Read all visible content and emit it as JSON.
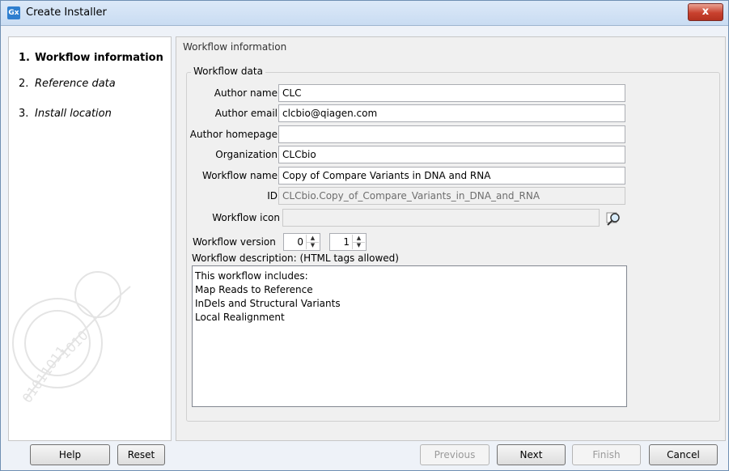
{
  "window": {
    "title": "Create Installer",
    "app_icon": "Gx",
    "close_label": "x"
  },
  "steps": [
    {
      "num": "1.",
      "label": "Workflow information",
      "state": "active"
    },
    {
      "num": "2.",
      "label": "Reference data",
      "state": "inactive"
    },
    {
      "num": "3.",
      "label": "Install location",
      "state": "inactive"
    }
  ],
  "section_title": "Workflow information",
  "group_title": "Workflow data",
  "form": {
    "author_name": {
      "label": "Author name",
      "value": "CLC"
    },
    "author_email": {
      "label": "Author email",
      "value": "clcbio@qiagen.com"
    },
    "author_homepage": {
      "label": "Author homepage",
      "value": ""
    },
    "organization": {
      "label": "Organization",
      "value": "CLCbio"
    },
    "workflow_name": {
      "label": "Workflow name",
      "value": "Copy of Compare Variants in DNA and RNA"
    },
    "id": {
      "label": "ID",
      "value": "CLCbio.Copy_of_Compare_Variants_in_DNA_and_RNA"
    },
    "workflow_icon": {
      "label": "Workflow icon",
      "value": ""
    },
    "workflow_version": {
      "label": "Workflow version",
      "major": "0",
      "minor": "1"
    },
    "description": {
      "label": "Workflow description: (HTML tags allowed)",
      "value": "This workflow includes:\nMap Reads to Reference\nInDels and Structural Variants\nLocal Realignment"
    }
  },
  "buttons": {
    "help": "Help",
    "reset": "Reset",
    "previous": "Previous",
    "next": "Next",
    "finish": "Finish",
    "cancel": "Cancel"
  },
  "icons": {
    "browse": "browse-search-icon",
    "up_arrow": "▲",
    "down_arrow": "▼"
  }
}
